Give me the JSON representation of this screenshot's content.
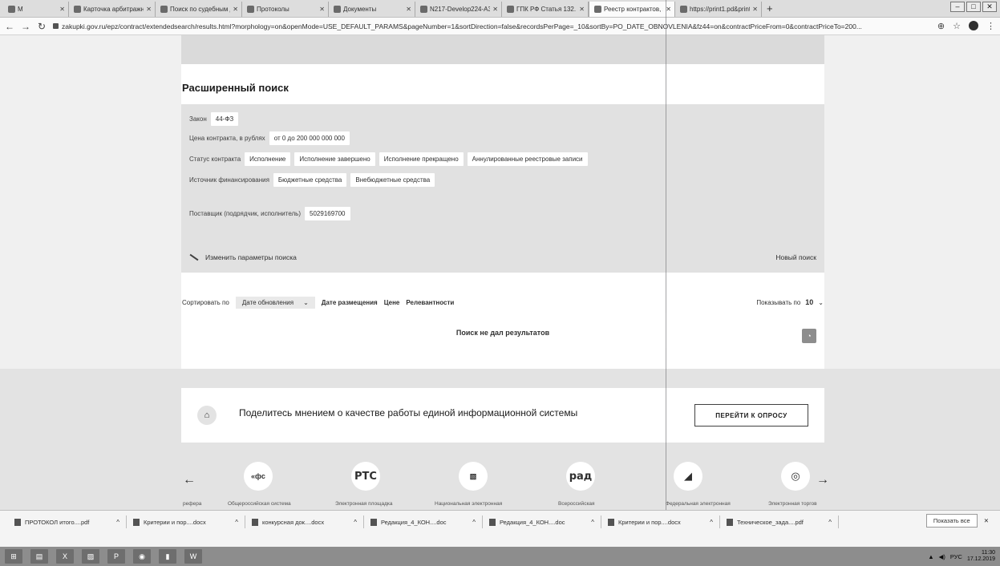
{
  "browser": {
    "tabs": [
      {
        "label": "M",
        "active": false
      },
      {
        "label": "Карточка арбитражного д",
        "active": false
      },
      {
        "label": "Поиск по судебным делам",
        "active": false
      },
      {
        "label": "Протоколы",
        "active": false
      },
      {
        "label": "Документы",
        "active": false
      },
      {
        "label": "N217-Develop224-A3-Colo",
        "active": false
      },
      {
        "label": "ГПК РФ Статья 132. Докум",
        "active": false
      },
      {
        "label": "Реестр контрактов, заклю",
        "active": true
      },
      {
        "label": "https://print1.pd&printId",
        "active": false
      }
    ],
    "new_tab": "+",
    "url": "zakupki.gov.ru/epz/contract/extendedsearch/results.html?morphology=on&openMode=USE_DEFAULT_PARAMS&pageNumber=1&sortDirection=false&recordsPerPage=_10&sortBy=PO_DATE_OBNOVLENIA&fz44=on&contractPriceFrom=0&contractPriceTo=200..."
  },
  "search": {
    "title": "Расширенный поиск",
    "law_label": "Закон",
    "law_value": "44-ФЗ",
    "price_label": "Цена контракта, в рублях",
    "price_value": "от 0 до 200 000 000 000",
    "status_label": "Статус контракта",
    "statuses": [
      "Исполнение",
      "Исполнение завершено",
      "Исполнение прекращено",
      "Аннулированные реестровые записи"
    ],
    "source_label": "Источник финансирования",
    "sources": [
      "Бюджетные средства",
      "Внебюджетные средства"
    ],
    "supplier_label": "Поставщик (подрядчик, исполнитель)",
    "supplier_value": "5029169700",
    "edit_link": "Изменить параметры поиска",
    "new_search": "Новый поиск"
  },
  "sort": {
    "label": "Сортировать по",
    "selected": "Дате обновления",
    "options": [
      "Дате размещения",
      "Цене",
      "Релевантности"
    ],
    "show_label": "Показывать по",
    "show_value": "10"
  },
  "results": {
    "empty_text": "Поиск не дал результатов"
  },
  "survey": {
    "text": "Поделитесь мнением о качестве работы единой информационной системы",
    "button": "ПЕРЕЙТИ К ОПРОСУ"
  },
  "partners": [
    {
      "logo": "«фс",
      "label": "Общероссийская система"
    },
    {
      "logo": "РТС",
      "label": "Электронная площадка"
    },
    {
      "logo": "▧",
      "label": "Национальная электронная"
    },
    {
      "logo": "рад",
      "label": "Всероссийская"
    },
    {
      "logo": "◢",
      "label": "Федеральная электронная"
    },
    {
      "logo": "◎",
      "label": "Электронная торгов"
    }
  ],
  "partners_first_label": "рефера",
  "downloads": [
    "ПРОТОКОЛ итого....pdf",
    "Критерии и пор....docx",
    "конкурсная док....docx",
    "Редакция_4_КОН....doc",
    "Редакция_4_КОН....doc",
    "Критерии и пор....docx",
    "Техническое_зада....pdf"
  ],
  "downloads_show_all": "Показать все",
  "taskbar": {
    "lang": "РУС",
    "time": "11:30",
    "date": "17.12.2019"
  }
}
